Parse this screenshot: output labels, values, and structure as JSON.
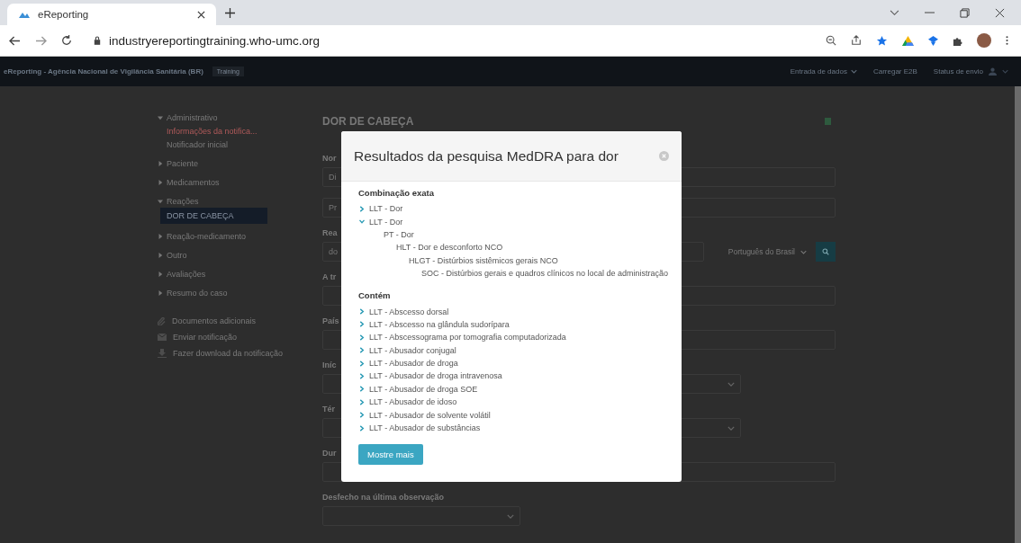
{
  "browser": {
    "tab_title": "eReporting",
    "url": "industryereportingtraining.who-umc.org"
  },
  "navbar": {
    "brand": "eReporting - Agência Nacional de Vigilância Sanitária (BR)",
    "badge": "Training",
    "items": [
      {
        "label": "Entrada de dados",
        "dropdown": true
      },
      {
        "label": "Carregar E2B",
        "dropdown": false
      },
      {
        "label": "Status de envio",
        "dropdown": false
      }
    ]
  },
  "sidebar": {
    "sections": [
      {
        "label": "Administrativo",
        "expanded": true,
        "children": [
          {
            "label": "Informações da notifica...",
            "selected": false,
            "error": true
          },
          {
            "label": "Notificador inicial",
            "selected": false,
            "error": false
          }
        ]
      },
      {
        "label": "Paciente",
        "expanded": false
      },
      {
        "label": "Medicamentos",
        "expanded": false
      },
      {
        "label": "Reações",
        "expanded": true,
        "children": [
          {
            "label": "DOR DE CABEÇA",
            "selected": true,
            "error": false
          }
        ]
      },
      {
        "label": "Reação-medicamento",
        "expanded": false
      },
      {
        "label": "Outro",
        "expanded": false
      },
      {
        "label": "Avaliações",
        "expanded": false
      },
      {
        "label": "Resumo do caso",
        "expanded": false
      }
    ],
    "actions": [
      {
        "kind": "attach",
        "label": "Documentos adicionais"
      },
      {
        "kind": "mail",
        "label": "Enviar notificação"
      },
      {
        "kind": "download",
        "label": "Fazer download da notificação"
      }
    ]
  },
  "form": {
    "title": "DOR DE CABEÇA",
    "fields": [
      {
        "kind": "text",
        "label": "Nor",
        "value": "Di"
      },
      {
        "kind": "text",
        "value": "Pr"
      },
      {
        "kind": "search",
        "label": "Rea",
        "value": "do",
        "language": "Português do Brasil"
      },
      {
        "kind": "text",
        "label": "A tr"
      },
      {
        "kind": "text",
        "label": "País"
      },
      {
        "kind": "select",
        "label": "Iníc"
      },
      {
        "kind": "select",
        "label": "Tér"
      },
      {
        "kind": "text",
        "label": "Dur"
      },
      {
        "kind": "short-select",
        "label": "Desfecho na última observação"
      }
    ]
  },
  "modal": {
    "title": "Resultados da pesquisa MedDRA para dor",
    "sections": [
      {
        "heading": "Combinação exata",
        "items": [
          {
            "label": "LLT - Dor",
            "expanded": false
          },
          {
            "label": "LLT - Dor",
            "expanded": true,
            "children": [
              {
                "label": "PT - Dor",
                "children": [
                  {
                    "label": "HLT - Dor e desconforto NCO",
                    "children": [
                      {
                        "label": "HLGT - Distúrbios sistêmicos gerais NCO",
                        "children": [
                          {
                            "label": "SOC - Distúrbios gerais e quadros clínicos no local de administração"
                          }
                        ]
                      }
                    ]
                  }
                ]
              }
            ]
          }
        ]
      },
      {
        "heading": "Contém",
        "items": [
          {
            "label": "LLT - Abscesso dorsal",
            "expanded": false
          },
          {
            "label": "LLT - Abscesso na glândula sudorípara",
            "expanded": false
          },
          {
            "label": "LLT - Abscessograma por tomografia computadorizada",
            "expanded": false
          },
          {
            "label": "LLT - Abusador conjugal",
            "expanded": false
          },
          {
            "label": "LLT - Abusador de droga",
            "expanded": false
          },
          {
            "label": "LLT - Abusador de droga intravenosa",
            "expanded": false
          },
          {
            "label": "LLT - Abusador de droga SOE",
            "expanded": false
          },
          {
            "label": "LLT - Abusador de idoso",
            "expanded": false
          },
          {
            "label": "LLT - Abusador de solvente volátil",
            "expanded": false
          },
          {
            "label": "LLT - Abusador de substâncias",
            "expanded": false
          }
        ]
      }
    ],
    "button": "Mostre mais"
  }
}
